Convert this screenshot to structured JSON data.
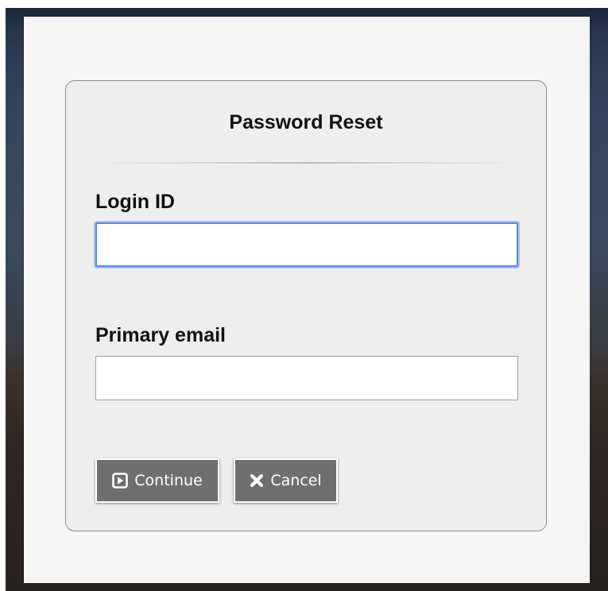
{
  "dialog": {
    "title": "Password Reset",
    "fields": {
      "login_id": {
        "label": "Login ID",
        "value": "",
        "placeholder": ""
      },
      "primary_email": {
        "label": "Primary email",
        "value": "",
        "placeholder": ""
      }
    },
    "buttons": {
      "continue": {
        "label": "Continue",
        "icon": "play-square-icon"
      },
      "cancel": {
        "label": "Cancel",
        "icon": "close-icon"
      }
    }
  },
  "colors": {
    "button_bg": "#6f6f6f",
    "focus_ring": "#5a8ae0",
    "panel_bg": "#eeeeee",
    "modal_bg": "#f5f5f5"
  }
}
